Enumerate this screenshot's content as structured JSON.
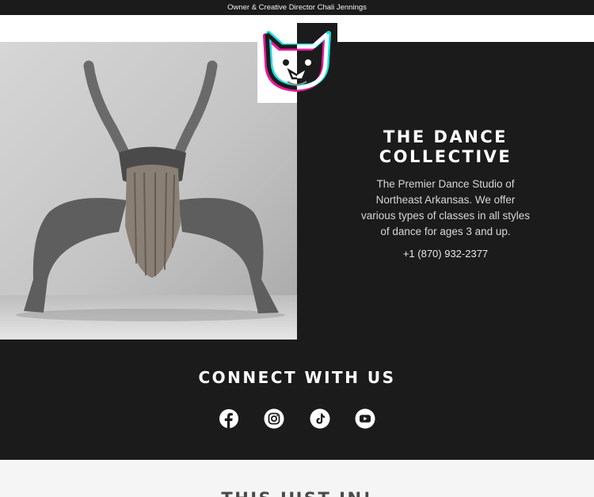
{
  "topbar": {
    "text": "Owner & Creative Director Chali Jennings"
  },
  "logo": {
    "icon": "french-bulldog-logo-icon"
  },
  "hero": {
    "image": "dancer-photo",
    "title": "The Dance Collective",
    "description": "The Premier Dance Studio of Northeast Arkansas. We offer various types of classes in all styles of dance for  ages 3 and up.",
    "phone": "+1 (870) 932-2377"
  },
  "connect": {
    "title": "Connect With Us",
    "icons": [
      "facebook-icon",
      "instagram-icon",
      "tiktok-icon",
      "youtube-icon"
    ]
  },
  "news": {
    "title": "This Just In!"
  },
  "colors": {
    "dark_bg": "#1c1b1b",
    "white": "#ffffff",
    "light_bg": "#f5f5f5",
    "logo_cyan": "#19e0e0",
    "logo_magenta": "#e8199a"
  }
}
